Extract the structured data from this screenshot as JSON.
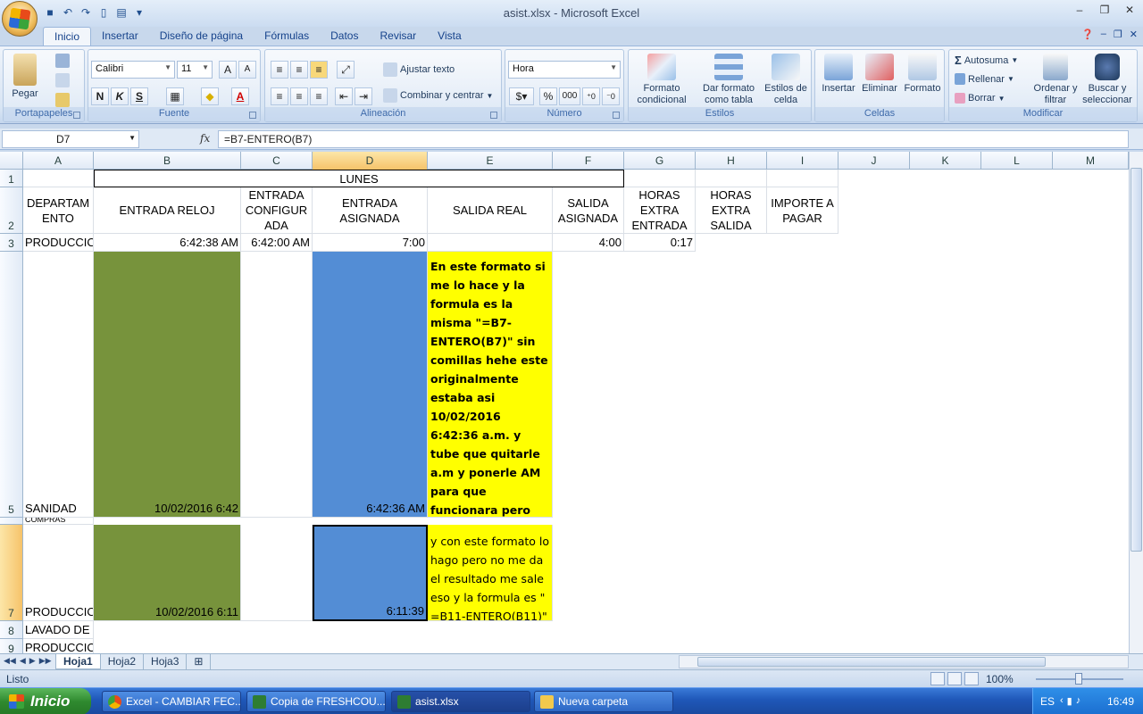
{
  "window": {
    "title": "asist.xlsx - Microsoft Excel"
  },
  "ribbon": {
    "tabs": [
      "Inicio",
      "Insertar",
      "Diseño de página",
      "Fórmulas",
      "Datos",
      "Revisar",
      "Vista"
    ],
    "portapapeles": {
      "label": "Portapapeles",
      "pegar": "Pegar"
    },
    "fuente": {
      "label": "Fuente",
      "font_name": "Calibri",
      "font_size": "11",
      "bold": "N",
      "italic": "K",
      "underline": "S"
    },
    "alineacion": {
      "label": "Alineación",
      "ajustar": "Ajustar texto",
      "combinar": "Combinar y centrar"
    },
    "numero": {
      "label": "Número",
      "format": "Hora",
      "percent": "%",
      "thousands": "000"
    },
    "estilos": {
      "label": "Estilos",
      "formato_cond": "Formato condicional",
      "formato_tabla": "Dar formato como tabla",
      "estilos_celda": "Estilos de celda"
    },
    "celdas": {
      "label": "Celdas",
      "insertar": "Insertar",
      "eliminar": "Eliminar",
      "formato": "Formato"
    },
    "modificar": {
      "label": "Modificar",
      "autosuma": "Autosuma",
      "rellenar": "Rellenar",
      "borrar": "Borrar",
      "ordenar": "Ordenar y filtrar",
      "buscar": "Buscar y seleccionar"
    }
  },
  "formula_bar": {
    "name_box": "D7",
    "fx": "fx",
    "formula": "=B7-ENTERO(B7)"
  },
  "grid": {
    "columns": [
      "A",
      "B",
      "C",
      "D",
      "E",
      "F",
      "G",
      "H",
      "I",
      "J",
      "K",
      "L",
      "M"
    ],
    "rows": [
      "1",
      "2",
      "3",
      "5",
      "6",
      "7",
      "8",
      "9"
    ],
    "r1": {
      "B": "LUNES"
    },
    "r2": {
      "A": "DEPARTAM ENTO",
      "B": "ENTRADA RELOJ",
      "C": "ENTRADA CONFIGUR ADA",
      "D": "ENTRADA ASIGNADA",
      "E": "SALIDA REAL",
      "F": "SALIDA ASIGNADA",
      "G": "HORAS EXTRA ENTRADA",
      "H": "HORAS EXTRA SALIDA",
      "I": "IMPORTE A PAGAR"
    },
    "r3": {
      "A": "PRODUCCION",
      "B": "6:42:38 AM",
      "C": "6:42:00 AM",
      "D": "7:00",
      "F": "4:00",
      "G": "0:17"
    },
    "r5": {
      "A": "SANIDAD",
      "B": "10/02/2016 6:42",
      "D": "6:42:36 AM",
      "E": "En este formato si me lo hace y la formula es la misma    \"=B7-ENTERO(B7)\" sin comillas hehe este originalmente estaba asi 10/02/2016  6:42:36 a.m. y tube que quitarle a.m y ponerle AM para que funcionara pero seria manual"
    },
    "r6": {
      "A": "COMPRAS"
    },
    "r7": {
      "A": "PRODUCCION",
      "B": "10/02/2016 6:11",
      "D": "6:11:39",
      "E": "y con este formato lo hago pero no me da el resultado me sale eso y la formula es \" =B11-ENTERO(B11)\""
    },
    "r8": {
      "A": "LAVADO DE ROPA"
    },
    "r9": {
      "A": "PRODUCCION"
    }
  },
  "sheets": [
    "Hoja1",
    "Hoja2",
    "Hoja3"
  ],
  "status": {
    "text": "Listo",
    "zoom": "100%"
  },
  "taskbar": {
    "start": "Inicio",
    "tasks": [
      "Excel - CAMBIAR FEC...",
      "Copia de FRESHCOU...",
      "asist.xlsx",
      "Nueva carpeta"
    ],
    "lang": "ES",
    "time": "16:49"
  },
  "colors": {
    "green_fill": "#77933c",
    "blue_fill": "#538dd5",
    "yellow_fill": "#ffff00"
  }
}
